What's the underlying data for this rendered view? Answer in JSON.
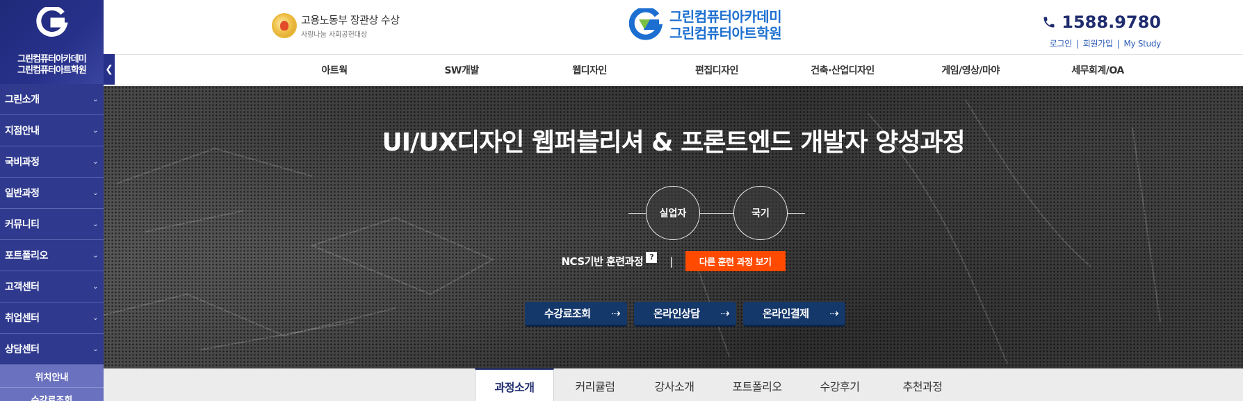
{
  "sidebar": {
    "brand_line1": "그린컴퓨터아카데미",
    "brand_line2": "그린컴퓨터아트학원",
    "toggle_icon": "chevron-left-icon",
    "items": [
      {
        "label": "그린소개"
      },
      {
        "label": "지점안내"
      },
      {
        "label": "국비과정"
      },
      {
        "label": "일반과정"
      },
      {
        "label": "커뮤니티"
      },
      {
        "label": "포트폴리오"
      },
      {
        "label": "고객센터"
      },
      {
        "label": "취업센터"
      },
      {
        "label": "상담센터"
      }
    ],
    "sub_items": [
      {
        "label": "위치안내"
      },
      {
        "label": "수강료조회"
      }
    ]
  },
  "header": {
    "award_title": "고용노동부 장관상 수상",
    "award_sub": "사랑나눔 사회공헌대상",
    "brand_line1": "그린컴퓨터아카데미",
    "brand_line2": "그린컴퓨터아트학원",
    "phone": "1588.9780",
    "links": [
      "로그인",
      "회원가입",
      "My Study"
    ],
    "brand_color": "#1c6fd0"
  },
  "nav": {
    "items": [
      {
        "label": "아트웍"
      },
      {
        "label": "SW개발"
      },
      {
        "label": "웹디자인"
      },
      {
        "label": "편집디자인"
      },
      {
        "label": "건축·산업디자인"
      },
      {
        "label": "게임/영상/마야"
      },
      {
        "label": "세무회계/OA"
      }
    ]
  },
  "hero": {
    "title": "UI/UX디자인 웹퍼블리셔 & 프론트엔드 개발자 양성과정",
    "badges": [
      "실업자",
      "국기"
    ],
    "ncs_label": "NCS기반 훈련과정",
    "ncs_help": "?",
    "divider": "|",
    "other_button": "다른 훈련 과정 보기",
    "other_button_color": "#ff4a00",
    "actions": [
      {
        "label": "수강료조회"
      },
      {
        "label": "온라인상담"
      },
      {
        "label": "온라인결제"
      }
    ]
  },
  "tabs": {
    "items": [
      {
        "label": "과정소개",
        "active": true
      },
      {
        "label": "커리큘럼"
      },
      {
        "label": "강사소개"
      },
      {
        "label": "포트폴리오"
      },
      {
        "label": "수강후기"
      },
      {
        "label": "추천과정"
      }
    ]
  }
}
